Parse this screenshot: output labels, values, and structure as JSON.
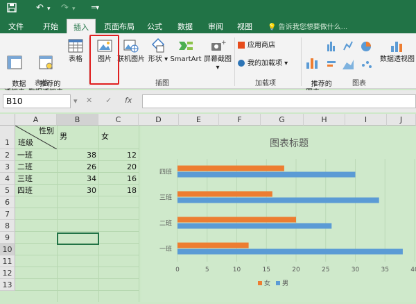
{
  "title_bar": {
    "save_icon": "save-icon",
    "undo_icon": "undo-icon",
    "redo_icon": "redo-icon"
  },
  "tabs": [
    "文件",
    "开始",
    "插入",
    "页面布局",
    "公式",
    "数据",
    "审阅",
    "视图"
  ],
  "tell_me": "告诉我您想要做什么...",
  "ribbon": {
    "pivot": "数据\n透视表",
    "recommended_pivot": "推荐的\n数据透视表",
    "table": "表格",
    "picture": "图片",
    "online_picture": "联机图片",
    "shapes": "形状",
    "smartart": "SmartArt",
    "screenshot": "屏幕截图",
    "app_store": "应用商店",
    "my_addins": "我的加载项",
    "recommended_charts": "推荐的\n图表",
    "pivot_chart": "数据透视图",
    "groups": {
      "tables": "表格",
      "illustrations": "插图",
      "addins": "加载项",
      "charts": "图表"
    }
  },
  "formula_bar": {
    "name_box": "B10",
    "fx": "fx",
    "cancel": "✕",
    "enter": "✓",
    "value": ""
  },
  "columns": [
    "A",
    "B",
    "C",
    "D",
    "E",
    "F",
    "G",
    "H",
    "I",
    "J"
  ],
  "rows": [
    "1",
    "2",
    "3",
    "4",
    "5",
    "6",
    "7",
    "8",
    "9",
    "10",
    "11",
    "12",
    "13"
  ],
  "header": {
    "gender": "性别",
    "class": "班级",
    "male": "男",
    "female": "女"
  },
  "table": [
    {
      "cls": "一班",
      "male": "38",
      "female": "12"
    },
    {
      "cls": "二班",
      "male": "26",
      "female": "20"
    },
    {
      "cls": "三班",
      "male": "34",
      "female": "16"
    },
    {
      "cls": "四班",
      "male": "30",
      "female": "18"
    }
  ],
  "chart_data": {
    "type": "bar",
    "orientation": "horizontal",
    "title": "图表标题",
    "categories": [
      "一班",
      "二班",
      "三班",
      "四班"
    ],
    "series": [
      {
        "name": "女",
        "values": [
          12,
          20,
          16,
          18
        ],
        "color": "#ed7d31"
      },
      {
        "name": "男",
        "values": [
          38,
          26,
          34,
          30
        ],
        "color": "#5b9bd5"
      }
    ],
    "xlim": [
      0,
      40
    ],
    "xticks": [
      "0",
      "5",
      "10",
      "15",
      "20",
      "25",
      "30",
      "35",
      "40"
    ],
    "legend": "bottom"
  }
}
